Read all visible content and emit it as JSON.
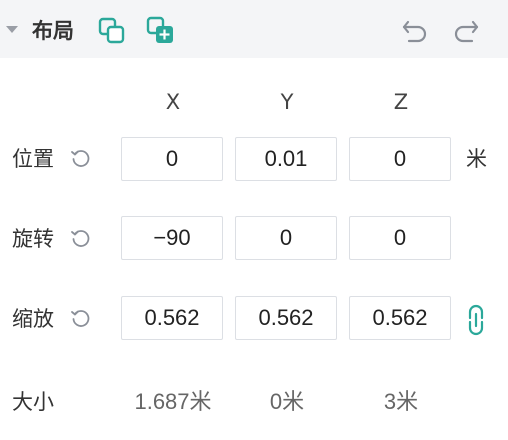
{
  "panel": {
    "title": "布局",
    "icons": {
      "collapse": "caret-down-icon",
      "copy": "copy-icon",
      "paste": "paste-add-icon",
      "undo": "undo-icon",
      "redo": "redo-icon"
    },
    "accent_color": "#2ba89a"
  },
  "axes": [
    "X",
    "Y",
    "Z"
  ],
  "position": {
    "label": "位置",
    "x": "0",
    "y": "0.01",
    "z": "0",
    "unit": "米"
  },
  "rotation": {
    "label": "旋转",
    "x": "−90",
    "y": "0",
    "z": "0"
  },
  "scale": {
    "label": "缩放",
    "x": "0.562",
    "y": "0.562",
    "z": "0.562",
    "lock_icon": "link-icon"
  },
  "size": {
    "label": "大小",
    "x": "1.687米",
    "y": "0米",
    "z": "3米"
  }
}
